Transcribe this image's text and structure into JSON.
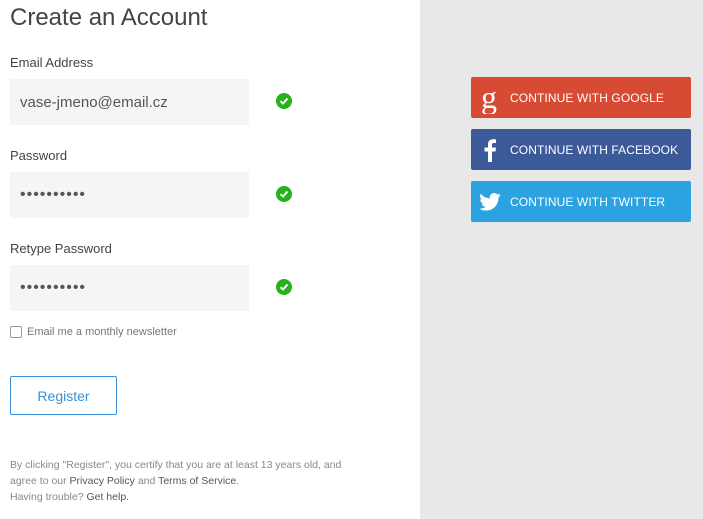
{
  "form": {
    "title": "Create an Account",
    "email_label": "Email Address",
    "email_value": "vase-jmeno@email.cz",
    "password_label": "Password",
    "password_value": "••••••••••",
    "retype_label": "Retype Password",
    "retype_value": "••••••••••",
    "newsletter_label": "Email me a monthly newsletter",
    "newsletter_checked": false,
    "register_label": "Register"
  },
  "footer": {
    "text_1": "By clicking \"Register\", you certify that you are at least 13 years old, and",
    "text_2a": "agree to our ",
    "privacy_link": "Privacy Policy",
    "text_2b": " and ",
    "terms_link": "Terms of Service",
    "text_2c": ".",
    "trouble_text": "Having trouble? ",
    "help_link": "Get help."
  },
  "social": {
    "google_label": "CONTINUE WITH GOOGLE",
    "facebook_label": "CONTINUE WITH FACEBOOK",
    "twitter_label": "CONTINUE WITH TWITTER",
    "colors": {
      "google": "#d74a34",
      "facebook": "#3c5a99",
      "twitter": "#2aa3e0"
    },
    "icons": [
      "google-g-icon",
      "facebook-f-icon",
      "twitter-bird-icon"
    ]
  },
  "colors": {
    "check": "#27b11c",
    "accent": "#3a8fd8",
    "right_panel": "#e8e8e8"
  }
}
